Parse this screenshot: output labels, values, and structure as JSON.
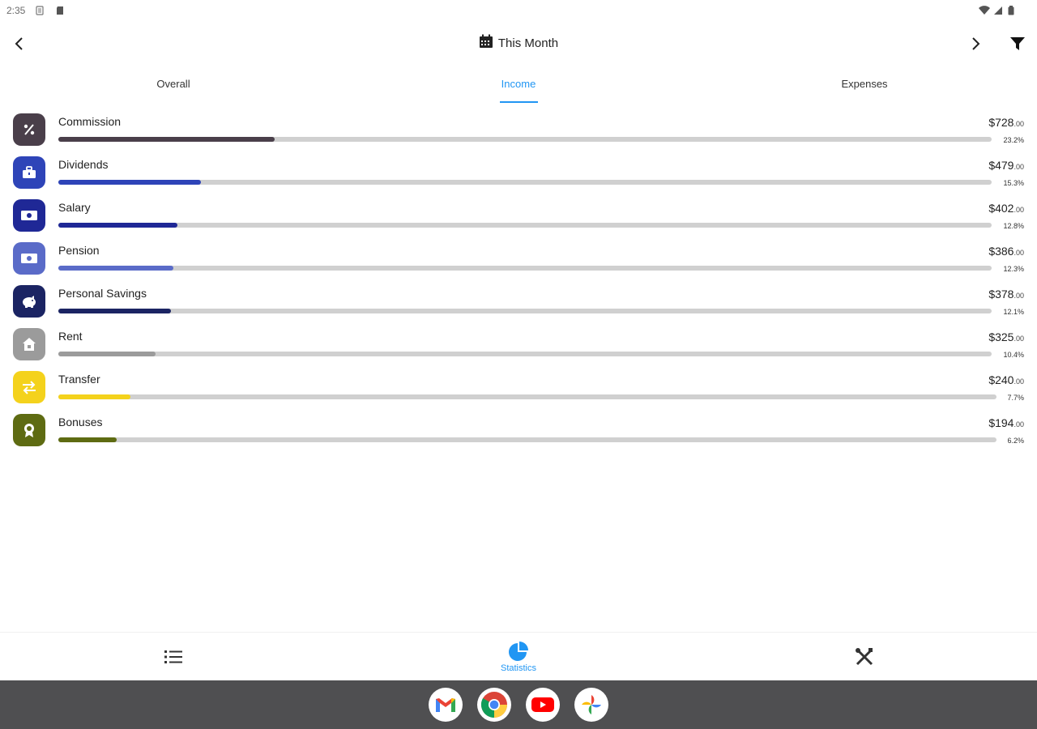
{
  "status_bar": {
    "time": "2:35"
  },
  "header": {
    "period_label": "This Month"
  },
  "tabs": [
    {
      "label": "Overall"
    },
    {
      "label": "Income"
    },
    {
      "label": "Expenses"
    }
  ],
  "active_tab": "Income",
  "categories": [
    {
      "name": "Commission",
      "amount": "$728",
      "cents": ".00",
      "percent": "23.2%",
      "share": 0.232,
      "color": "#4a3f4a",
      "icon": "percent-icon"
    },
    {
      "name": "Dividends",
      "amount": "$479",
      "cents": ".00",
      "percent": "15.3%",
      "share": 0.153,
      "color": "#2e44b8",
      "icon": "briefcase-icon"
    },
    {
      "name": "Salary",
      "amount": "$402",
      "cents": ".00",
      "percent": "12.8%",
      "share": 0.128,
      "color": "#1f2896",
      "icon": "money-icon"
    },
    {
      "name": "Pension",
      "amount": "$386",
      "cents": ".00",
      "percent": "12.3%",
      "share": 0.123,
      "color": "#5a6bc8",
      "icon": "money-icon"
    },
    {
      "name": "Personal Savings",
      "amount": "$378",
      "cents": ".00",
      "percent": "12.1%",
      "share": 0.121,
      "color": "#1b2463",
      "icon": "piggy-bank-icon"
    },
    {
      "name": "Rent",
      "amount": "$325",
      "cents": ".00",
      "percent": "10.4%",
      "share": 0.104,
      "color": "#9b9b9b",
      "icon": "house-icon"
    },
    {
      "name": "Transfer",
      "amount": "$240",
      "cents": ".00",
      "percent": "7.7%",
      "share": 0.077,
      "color": "#f4d21c",
      "icon": "transfer-icon"
    },
    {
      "name": "Bonuses",
      "amount": "$194",
      "cents": ".00",
      "percent": "6.2%",
      "share": 0.062,
      "color": "#5e6b12",
      "icon": "award-icon"
    }
  ],
  "bottom_nav": [
    {
      "label": "",
      "icon": "list-icon"
    },
    {
      "label": "Statistics",
      "icon": "pie-chart-icon"
    },
    {
      "label": "",
      "icon": "tools-icon"
    }
  ],
  "dock_apps": [
    {
      "icon": "gmail-icon"
    },
    {
      "icon": "chrome-icon"
    },
    {
      "icon": "youtube-icon"
    },
    {
      "icon": "photos-icon"
    }
  ],
  "colors": {
    "accent": "#2196f3",
    "track": "#d0d0d0",
    "dock": "#4f4f51"
  }
}
